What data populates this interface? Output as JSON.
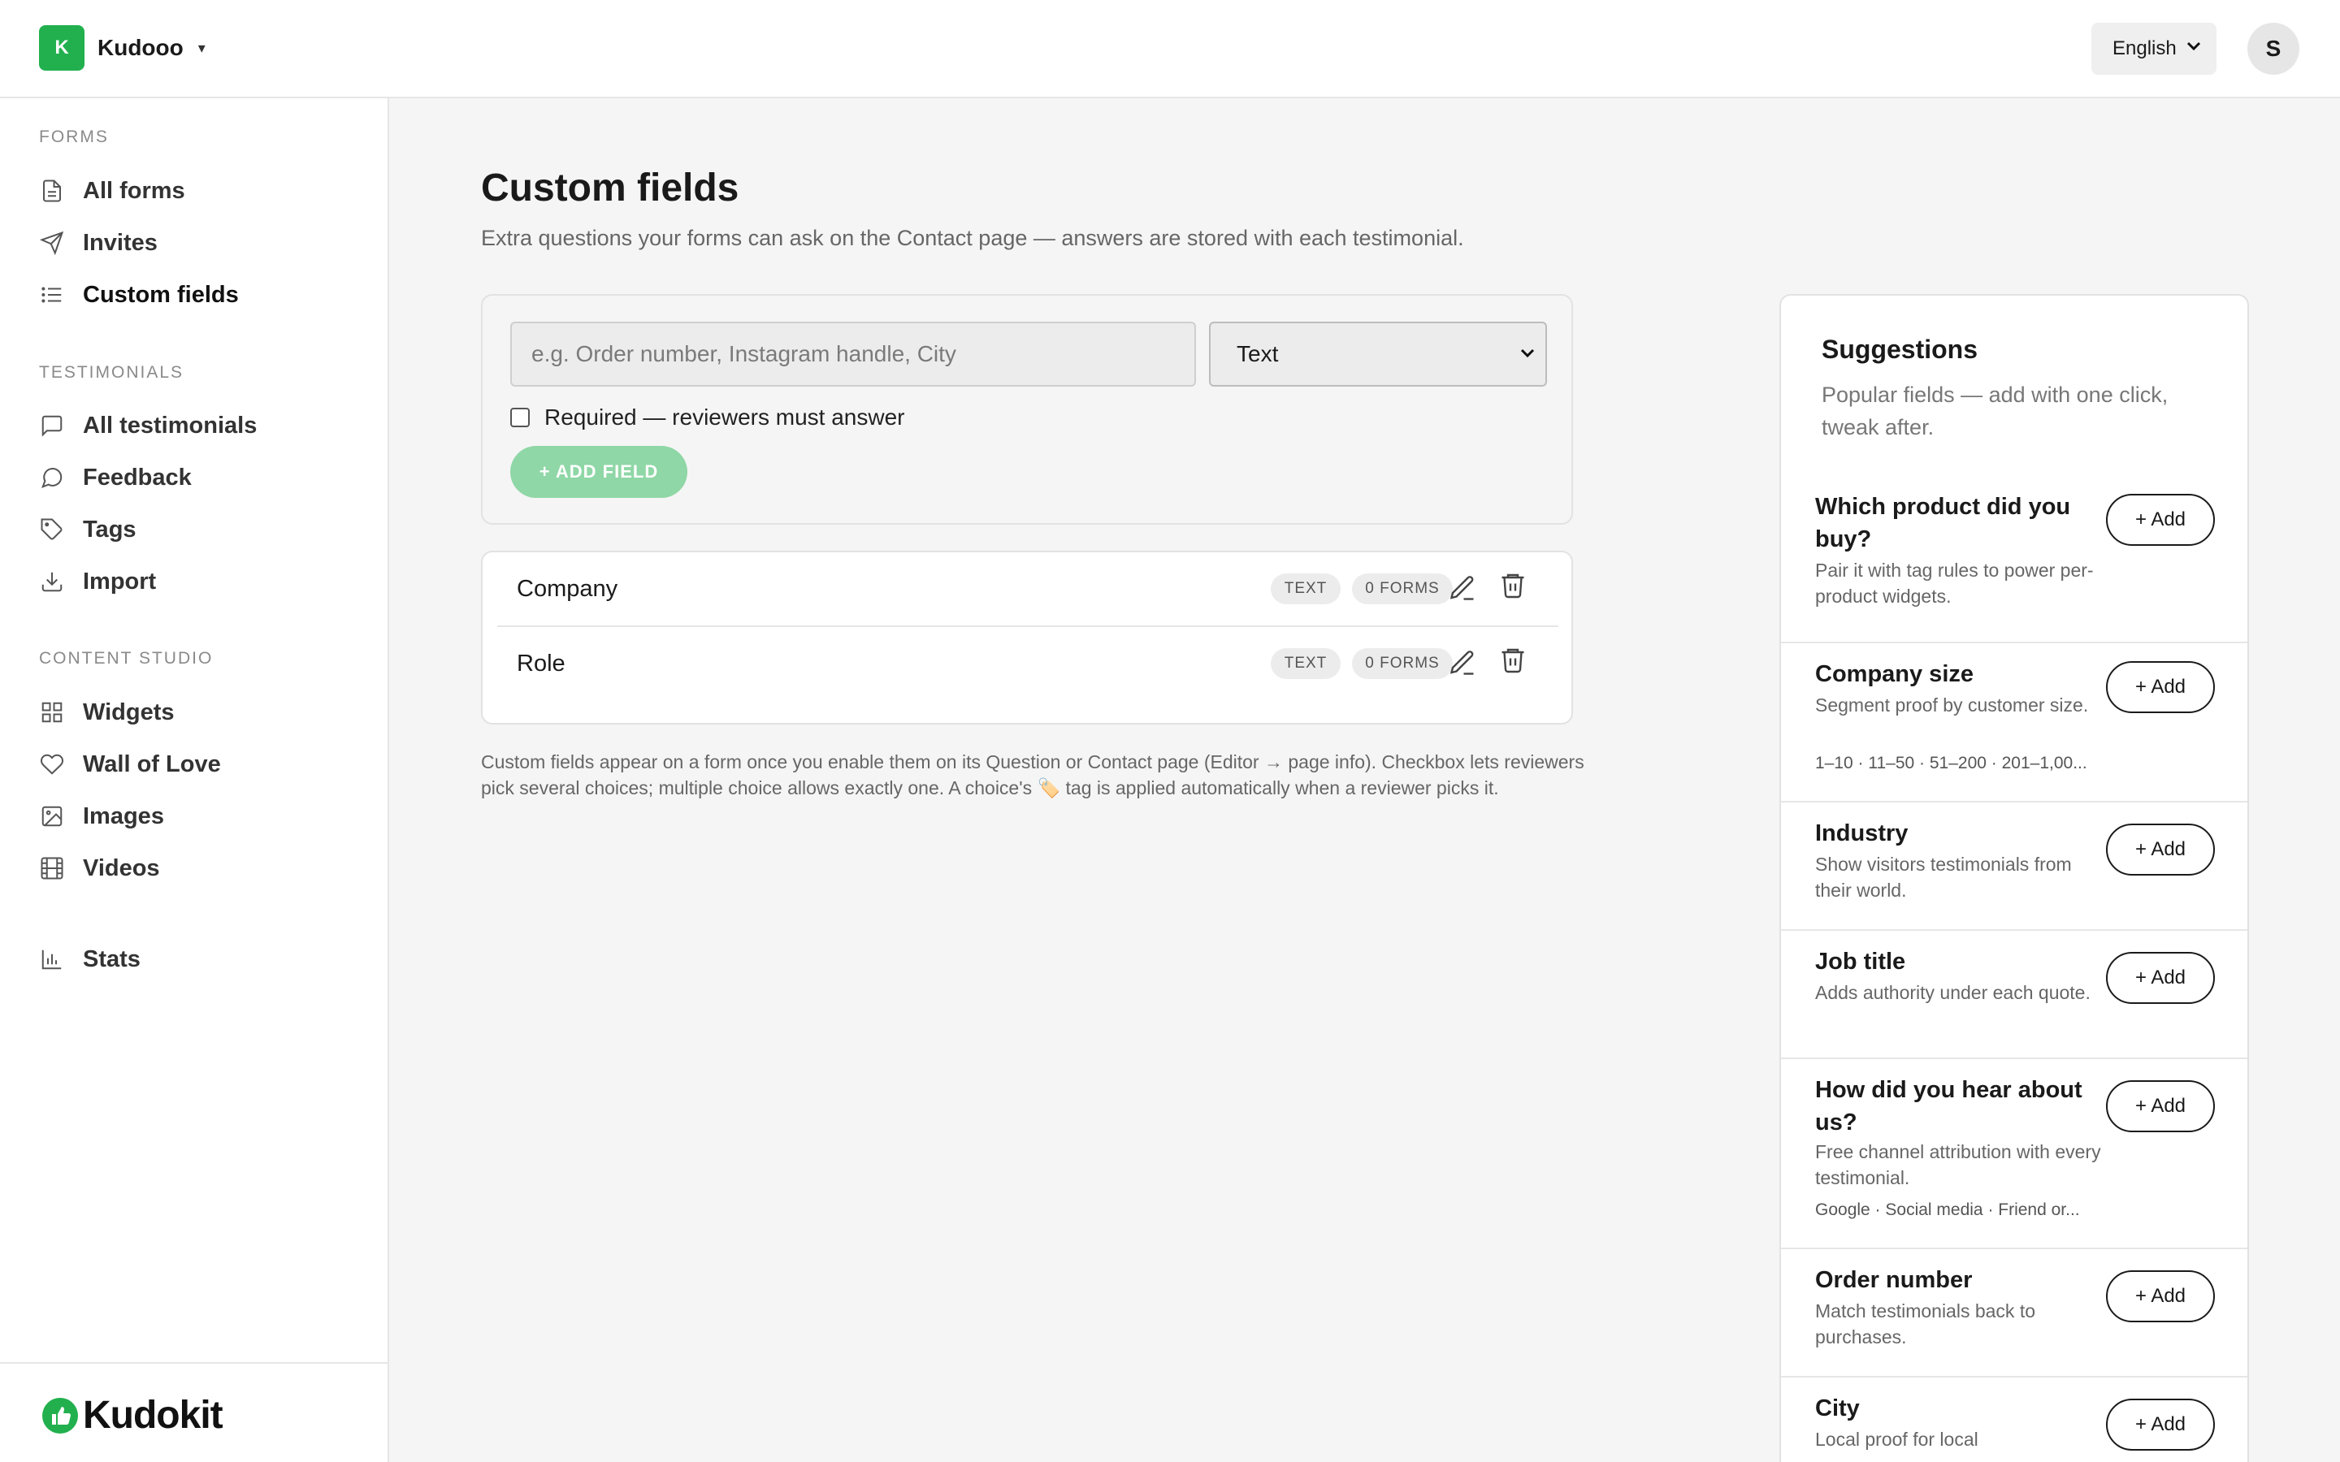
{
  "workspace": {
    "logo_letter": "K",
    "name": "Kudooo",
    "caret": "▾"
  },
  "header": {
    "language": "English",
    "avatar_initial": "S"
  },
  "sidebar": {
    "sections": [
      {
        "label": "FORMS",
        "items": [
          {
            "label": "All forms",
            "icon": "file-icon"
          },
          {
            "label": "Invites",
            "icon": "send-icon"
          },
          {
            "label": "Custom fields",
            "icon": "list-icon",
            "active": true
          }
        ]
      },
      {
        "label": "TESTIMONIALS",
        "items": [
          {
            "label": "All testimonials",
            "icon": "message-square-icon"
          },
          {
            "label": "Feedback",
            "icon": "message-circle-icon"
          },
          {
            "label": "Tags",
            "icon": "tag-icon"
          },
          {
            "label": "Import",
            "icon": "download-icon"
          }
        ]
      },
      {
        "label": "CONTENT STUDIO",
        "items": [
          {
            "label": "Widgets",
            "icon": "grid-icon"
          },
          {
            "label": "Wall of Love",
            "icon": "heart-icon"
          },
          {
            "label": "Images",
            "icon": "image-icon"
          },
          {
            "label": "Videos",
            "icon": "film-icon"
          }
        ]
      }
    ],
    "stats": {
      "label": "Stats",
      "icon": "bar-chart-icon"
    },
    "brand": "Kudokit"
  },
  "main": {
    "title": "Custom fields",
    "subtitle": "Extra questions your forms can ask on the Contact page — answers are stored with each testimonial.",
    "form": {
      "name_placeholder": "e.g. Order number, Instagram handle, City",
      "type_value": "Text",
      "required_label": "Required — reviewers must answer",
      "add_button": "+ ADD FIELD"
    },
    "fields": [
      {
        "name": "Company",
        "type": "TEXT",
        "forms": "0 FORMS"
      },
      {
        "name": "Role",
        "type": "TEXT",
        "forms": "0 FORMS"
      }
    ],
    "note": "Custom fields appear on a form once you enable them on its Question or Contact page (Editor → page info). Checkbox lets reviewers pick several choices; multiple choice allows exactly one. A choice's 🏷️ tag is applied automatically when a reviewer picks it."
  },
  "suggestions": {
    "title": "Suggestions",
    "subtitle": "Popular fields — add with one click, tweak after.",
    "add_label": "+ Add",
    "items": [
      {
        "title": "Which product did you buy?",
        "desc": "Pair it with tag rules to power per-product widgets.",
        "options": ""
      },
      {
        "title": "Company size",
        "desc": "Segment proof by customer size.",
        "options": "1–10 · 11–50 · 51–200 · 201–1,00..."
      },
      {
        "title": "Industry",
        "desc": "Show visitors testimonials from their world.",
        "options": ""
      },
      {
        "title": "Job title",
        "desc": "Adds authority under each quote.",
        "options": ""
      },
      {
        "title": "How did you hear about us?",
        "desc": "Free channel attribution with every testimonial.",
        "options": "Google · Social media · Friend or..."
      },
      {
        "title": "Order number",
        "desc": "Match testimonials back to purchases.",
        "options": ""
      },
      {
        "title": "City",
        "desc": "Local proof for local",
        "options": ""
      }
    ]
  },
  "colors": {
    "brand_green": "#22b04e",
    "add_field_disabled": "#8fd7a6",
    "page_bg": "#f5f5f5"
  }
}
